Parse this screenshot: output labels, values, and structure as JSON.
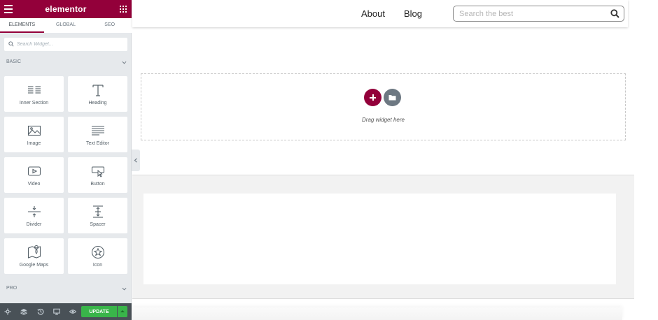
{
  "sidebar": {
    "logo": "elementor",
    "tabs": [
      {
        "label": "ELEMENTS"
      },
      {
        "label": "GLOBAL"
      },
      {
        "label": "SEO"
      }
    ],
    "search_placeholder": "Search Widget...",
    "sections": {
      "basic": "BASIC",
      "pro": "PRO"
    },
    "widgets": [
      {
        "label": "Inner Section",
        "icon": "inner-section-icon"
      },
      {
        "label": "Heading",
        "icon": "heading-icon"
      },
      {
        "label": "Image",
        "icon": "image-icon"
      },
      {
        "label": "Text Editor",
        "icon": "text-editor-icon"
      },
      {
        "label": "Video",
        "icon": "video-icon"
      },
      {
        "label": "Button",
        "icon": "button-icon"
      },
      {
        "label": "Divider",
        "icon": "divider-icon"
      },
      {
        "label": "Spacer",
        "icon": "spacer-icon"
      },
      {
        "label": "Google Maps",
        "icon": "google-maps-icon"
      },
      {
        "label": "Icon",
        "icon": "star-icon"
      }
    ],
    "footer": {
      "update_label": "UPDATE"
    }
  },
  "topnav": {
    "links": [
      "About",
      "Blog"
    ],
    "search_placeholder": "Search the best"
  },
  "canvas": {
    "dropzone_text": "Drag widget here"
  },
  "colors": {
    "brand": "#93003a",
    "update": "#39b54a",
    "footer": "#495157"
  }
}
